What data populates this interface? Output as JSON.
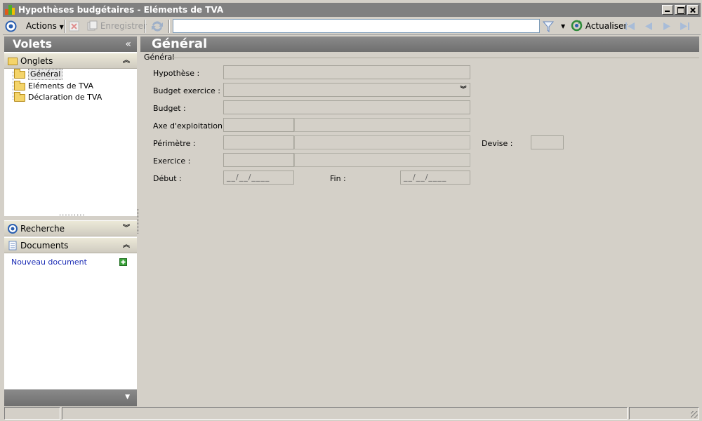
{
  "window": {
    "title": "Hypothèses budgétaires - Eléments de TVA"
  },
  "toolbar": {
    "actions_label": "Actions",
    "save_label": "Enregistrer",
    "search_value": "",
    "refresh_label": "Actualiser"
  },
  "left_pane": {
    "title": "Volets",
    "collapse_glyph": "«",
    "tabs_section": "Onglets",
    "tree": [
      {
        "label": "Général",
        "selected": true
      },
      {
        "label": "Eléments de TVA",
        "selected": false
      },
      {
        "label": "Déclaration de TVA",
        "selected": false
      }
    ],
    "search_section": "Recherche",
    "documents_section": "Documents",
    "new_document_link": "Nouveau document"
  },
  "main": {
    "title": "Général",
    "group_label": "Général",
    "fields": {
      "hypothese": {
        "label": "Hypothèse :",
        "value": ""
      },
      "budget_exercice": {
        "label": "Budget exercice :",
        "value": ""
      },
      "budget": {
        "label": "Budget :",
        "value": ""
      },
      "axe": {
        "label": "Axe d'exploitation :",
        "code": "",
        "value": ""
      },
      "perimetre": {
        "label": "Périmètre :",
        "code": "",
        "value": ""
      },
      "devise": {
        "label": "Devise :",
        "value": ""
      },
      "exercice": {
        "label": "Exercice :",
        "code": "",
        "value": ""
      },
      "debut": {
        "label": "Début :",
        "value": "__/__/____"
      },
      "fin": {
        "label": "Fin :",
        "value": "__/__/____"
      }
    }
  },
  "colors": {
    "header_gray": "#7c7c7c",
    "link_blue": "#1a2bb5",
    "dialog_bg": "#d4d0c8"
  }
}
